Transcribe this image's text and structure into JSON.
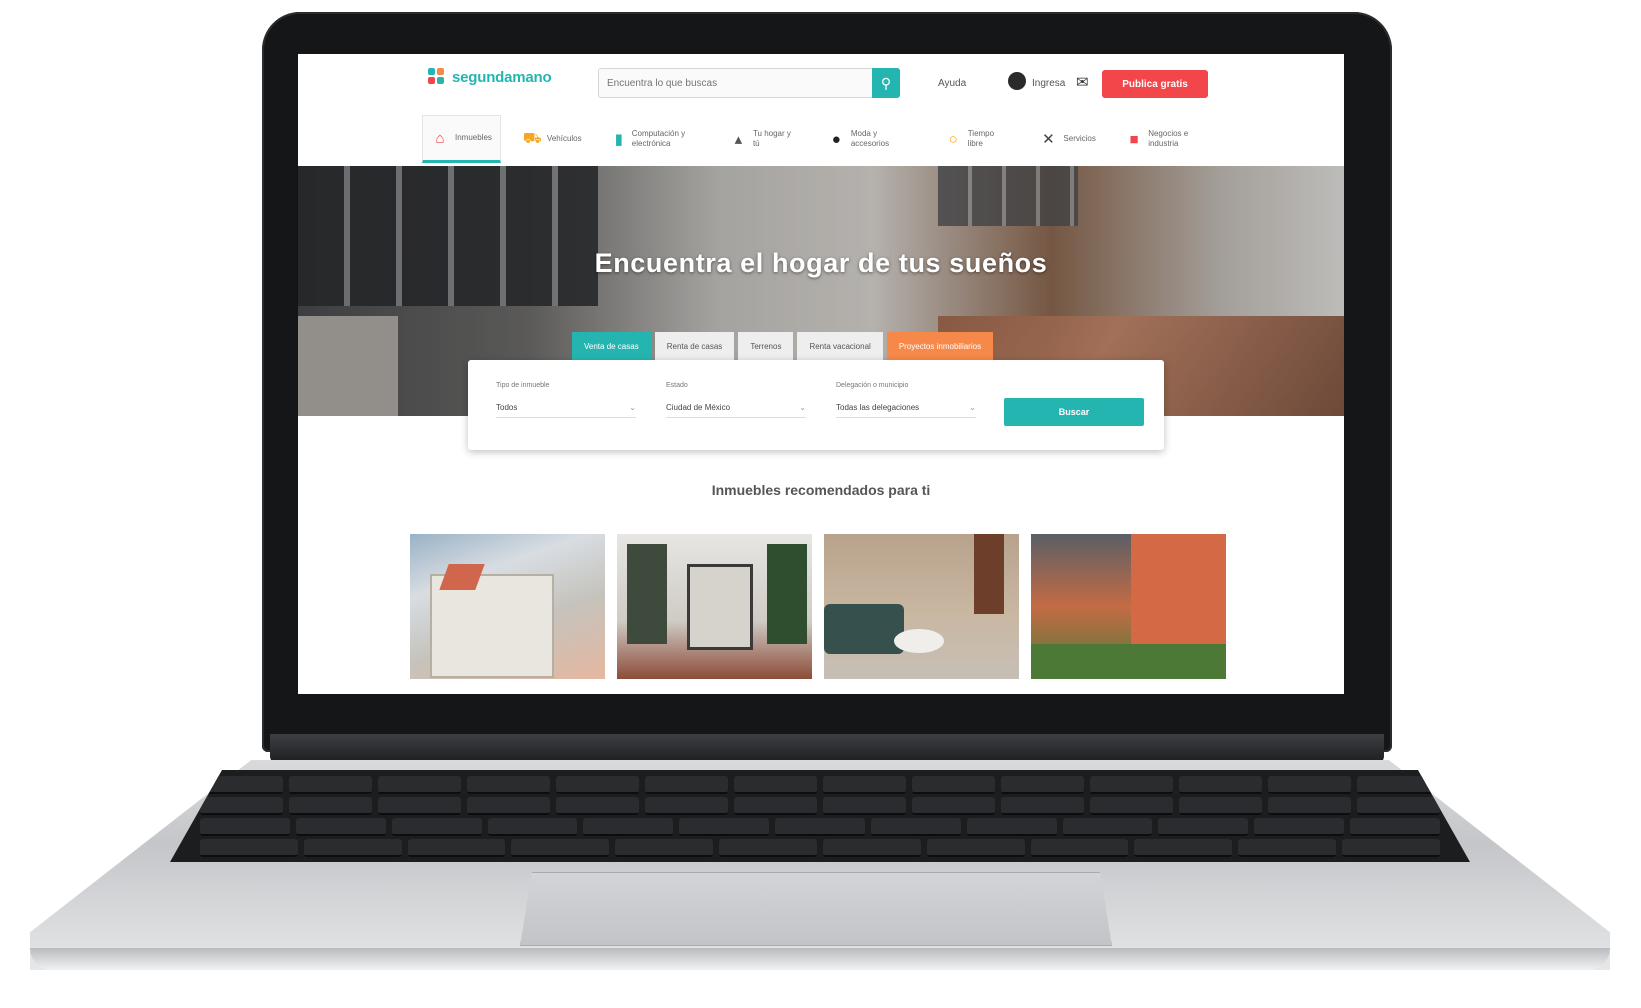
{
  "header": {
    "logo_text": "segundamano",
    "search_placeholder": "Encuentra lo que buscas",
    "links": {
      "help": "Ayuda",
      "login": "Ingresa"
    },
    "publish_label": "Publica gratis"
  },
  "categories": [
    {
      "label": "Inmuebles",
      "icon": "house-icon"
    },
    {
      "label": "Vehículos",
      "icon": "car-icon"
    },
    {
      "label": "Computación y electrónica",
      "icon": "phone-icon"
    },
    {
      "label": "Tu hogar y tú",
      "icon": "sofa-icon"
    },
    {
      "label": "Moda y accesorios",
      "icon": "bag-icon"
    },
    {
      "label": "Tiempo libre",
      "icon": "bike-icon"
    },
    {
      "label": "Servicios",
      "icon": "tools-icon"
    },
    {
      "label": "Negocios e industria",
      "icon": "store-icon"
    }
  ],
  "hero": {
    "title": "Encuentra el hogar de tus sueños",
    "tabs": [
      {
        "label": "Venta de casas"
      },
      {
        "label": "Renta de casas"
      },
      {
        "label": "Terrenos"
      },
      {
        "label": "Renta vacacional"
      },
      {
        "label": "Proyectos inmobiliarios"
      }
    ]
  },
  "search_panel": {
    "fields": [
      {
        "label": "Tipo de inmueble",
        "value": "Todos"
      },
      {
        "label": "Estado",
        "value": "Ciudad de México"
      },
      {
        "label": "Delegación o municipio",
        "value": "Todas las delegaciones"
      }
    ],
    "submit_label": "Buscar"
  },
  "recommended": {
    "title": "Inmuebles recomendados para ti",
    "cards": [
      {
        "caption": ""
      },
      {
        "caption": ""
      },
      {
        "caption": ""
      },
      {
        "caption": ""
      }
    ]
  },
  "colors": {
    "brand": "#25b5b0",
    "publish": "#f2464b",
    "accent_orange": "#f6894a"
  }
}
